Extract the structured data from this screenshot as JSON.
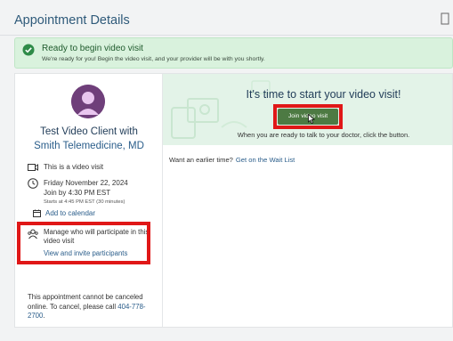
{
  "header": {
    "title": "Appointment Details",
    "print_icon": "print-icon"
  },
  "banner": {
    "icon": "check-circle-icon",
    "title": "Ready to begin video visit",
    "subtitle": "We're ready for you! Begin the video visit, and your provider will be with you shortly.",
    "color": "#d9f2dd"
  },
  "provider": {
    "avatar_icon": "person-avatar-icon",
    "name_line1": "Test Video Client with",
    "name_line2": "Smith Telemedicine, MD"
  },
  "details": {
    "video_label": "This is a video visit",
    "date": "Friday November 22, 2024",
    "join_by": "Join by 4:30 PM EST",
    "starts_at": "Starts at 4:45 PM EST (30 minutes)",
    "add_to_calendar": "Add to calendar"
  },
  "participants": {
    "manage_text": "Manage who will participate in this video visit",
    "invite_link": "View and invite participants"
  },
  "cancel": {
    "text": "This appointment cannot be canceled online. To cancel, please call",
    "phone": "404-778-2700",
    "suffix": "."
  },
  "visit": {
    "title": "It's time to start your video visit!",
    "join_button": "Join video visit",
    "hint": "When you are ready to talk to your doctor, click the button.",
    "button_color": "#4d7a43"
  },
  "waitlist": {
    "prompt": "Want an earlier time?",
    "link": "Get on the Wait List"
  },
  "annotation_color": "#e01717"
}
